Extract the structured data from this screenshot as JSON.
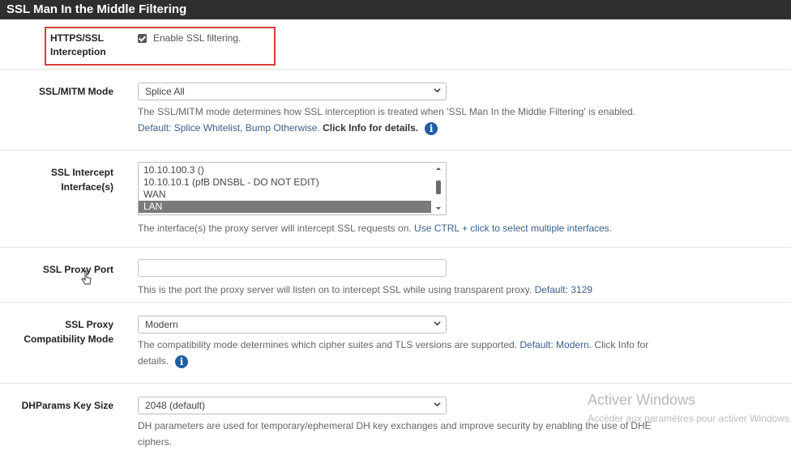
{
  "panel": {
    "title": "SSL Man In the Middle Filtering"
  },
  "fields": {
    "https_interception": {
      "label_line1": "HTTPS/SSL",
      "label_line2": "Interception",
      "checkbox_label": "Enable SSL filtering.",
      "checked": true
    },
    "mitm_mode": {
      "label": "SSL/MITM Mode",
      "selected": "Splice All",
      "help": "The SSL/MITM mode determines how SSL interception is treated when 'SSL Man In the Middle Filtering' is enabled.",
      "default_text": "Default: Splice Whitelist, Bump Otherwise.",
      "click_info": "Click Info for details."
    },
    "intercept_interfaces": {
      "label_line1": "SSL Intercept",
      "label_line2": "Interface(s)",
      "options": [
        "10.10.100.3 ()",
        "10.10.10.1 (pfB DNSBL - DO NOT EDIT)",
        "WAN",
        "LAN"
      ],
      "selected": "LAN",
      "help": "The interface(s) the proxy server will intercept SSL requests on.",
      "help_hint": "Use CTRL + click to select multiple interfaces."
    },
    "proxy_port": {
      "label": "SSL Proxy Port",
      "value": "",
      "help": "This is the port the proxy server will listen on to intercept SSL while using transparent proxy.",
      "default_text": "Default: 3129"
    },
    "compat_mode": {
      "label_line1": "SSL Proxy",
      "label_line2": "Compatibility Mode",
      "selected": "Modern",
      "help": "The compatibility mode determines which cipher suites and TLS versions are supported.",
      "default_text": "Default: Modern.",
      "click_info_line1": "Click Info for",
      "click_info_line2": "details."
    },
    "dhparams": {
      "label": "DHParams Key Size",
      "selected": "2048 (default)",
      "help_line1": "DH parameters are used for temporary/ephemeral DH key exchanges and improve security by enabling the use of DHE",
      "help_line2": "ciphers."
    }
  },
  "icons": {
    "info": "info-icon",
    "caret": "chevron-down-icon",
    "check": "checkmark-icon",
    "cursor": "mouse-pointer-icon"
  },
  "watermark": {
    "title": "Activer Windows",
    "subtitle": "Accéder aux paramètres pour activer Windows."
  },
  "colors": {
    "header_bg": "#2f2f2f",
    "highlight_border": "#d83c3c",
    "info_blue": "#1e5fa3",
    "link_blue": "#3a5f8a"
  }
}
